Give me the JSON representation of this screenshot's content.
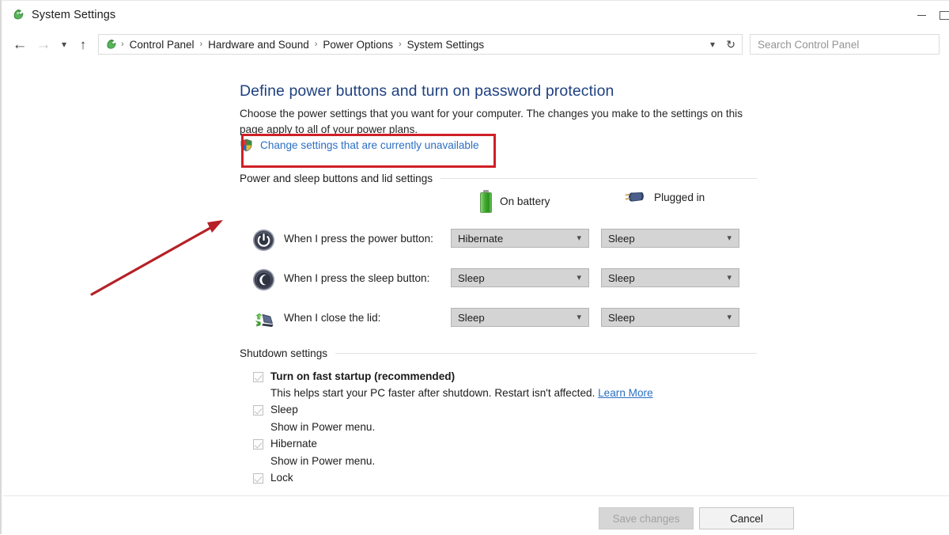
{
  "window": {
    "title": "System Settings",
    "icon": "control-panel-icon",
    "minimize_label": "Minimize"
  },
  "nav": {
    "back_icon": "back-arrow-icon",
    "forward_icon": "forward-arrow-icon",
    "recent_icon": "recent-locations-chevron-icon",
    "up_icon": "up-arrow-icon",
    "breadcrumb": [
      "Control Panel",
      "Hardware and Sound",
      "Power Options",
      "System Settings"
    ],
    "separator": "›",
    "dropdown_icon": "chevron-down-icon",
    "refresh_icon": "refresh-icon",
    "search_placeholder": "Search Control Panel"
  },
  "page": {
    "title": "Define power buttons and turn on password protection",
    "description": "Choose the power settings that you want for your computer. The changes you make to the settings on this page apply to all of your power plans.",
    "uac_link": "Change settings that are currently unavailable",
    "uac_icon": "uac-shield-icon"
  },
  "annotation": {
    "rect_color": "#cf2027",
    "arrow_color": "#b52126"
  },
  "power_section": {
    "heading": "Power and sleep buttons and lid settings",
    "columns": [
      {
        "label": "On battery",
        "icon": "battery-icon"
      },
      {
        "label": "Plugged in",
        "icon": "power-plug-icon"
      }
    ],
    "rows": [
      {
        "icon": "power-button-icon",
        "label": "When I press the power button:",
        "on_battery": "Hibernate",
        "plugged_in": "Sleep"
      },
      {
        "icon": "sleep-moon-icon",
        "label": "When I press the sleep button:",
        "on_battery": "Sleep",
        "plugged_in": "Sleep"
      },
      {
        "icon": "laptop-lid-icon",
        "label": "When I close the lid:",
        "on_battery": "Sleep",
        "plugged_in": "Sleep"
      }
    ],
    "combo_arrow_icon": "chevron-down-icon"
  },
  "shutdown_section": {
    "heading": "Shutdown settings",
    "items": [
      {
        "label": "Turn on fast startup (recommended)",
        "bold": true,
        "checked": true,
        "description": "This helps start your PC faster after shutdown. Restart isn't affected.",
        "link": "Learn More"
      },
      {
        "label": "Sleep",
        "bold": false,
        "checked": true,
        "description": "Show in Power menu.",
        "link": ""
      },
      {
        "label": "Hibernate",
        "bold": false,
        "checked": true,
        "description": "Show in Power menu.",
        "link": ""
      },
      {
        "label": "Lock",
        "bold": false,
        "checked": true,
        "description": "",
        "link": ""
      }
    ]
  },
  "footer": {
    "save_label": "Save changes",
    "save_enabled": false,
    "cancel_label": "Cancel",
    "cancel_enabled": true
  },
  "colors": {
    "heading": "#1f4180",
    "link": "#2b6fc4",
    "annotation": "#cf2027",
    "battery_green": "#3fab2e"
  }
}
